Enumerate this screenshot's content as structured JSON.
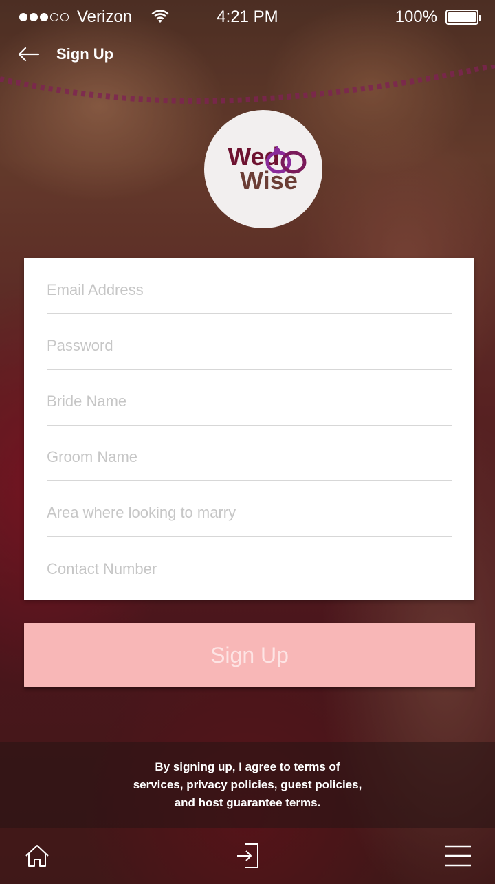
{
  "status_bar": {
    "carrier": "Verizon",
    "time": "4:21 PM",
    "battery": "100%"
  },
  "header": {
    "title": "Sign Up"
  },
  "logo": {
    "line1": "Wed",
    "line2": "Wise"
  },
  "form": {
    "email_placeholder": "Email Address",
    "password_placeholder": "Password",
    "bride_placeholder": "Bride Name",
    "groom_placeholder": "Groom Name",
    "area_placeholder": "Area where looking to marry",
    "contact_placeholder": "Contact Number"
  },
  "signup_button": {
    "label": "Sign Up"
  },
  "terms": {
    "text": "By signing up, I agree to  terms of services, privacy policies, guest policies, and host guarantee terms."
  },
  "tab_bar": {
    "icons": [
      "home-icon",
      "sign-in-icon",
      "menu-icon"
    ]
  },
  "colors": {
    "logo_primary": "#6e1230",
    "logo_secondary": "#6b3d35",
    "button_bg": "#f8b7b7",
    "card_bg": "#ffffff"
  }
}
